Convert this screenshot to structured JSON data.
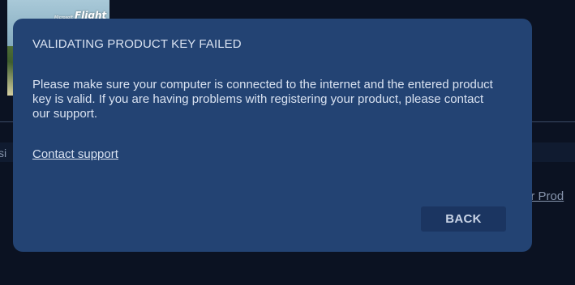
{
  "background": {
    "thumbnail_brand": "Flight",
    "thumbnail_brand_prefix": "Microsoft",
    "strip_text_partial": "si",
    "right_link_partial": "er Prod"
  },
  "dialog": {
    "title": "VALIDATING PRODUCT KEY FAILED",
    "message": "Please make sure your computer is connected to the internet and the entered product key is valid. If you are having problems with registering your product, please contact our support.",
    "support_link": "Contact support",
    "back_button": "BACK"
  },
  "colors": {
    "page_background": "#0b1222",
    "dialog_background": "#234373",
    "button_background": "#1b3561",
    "text": "#d9e2f1"
  }
}
